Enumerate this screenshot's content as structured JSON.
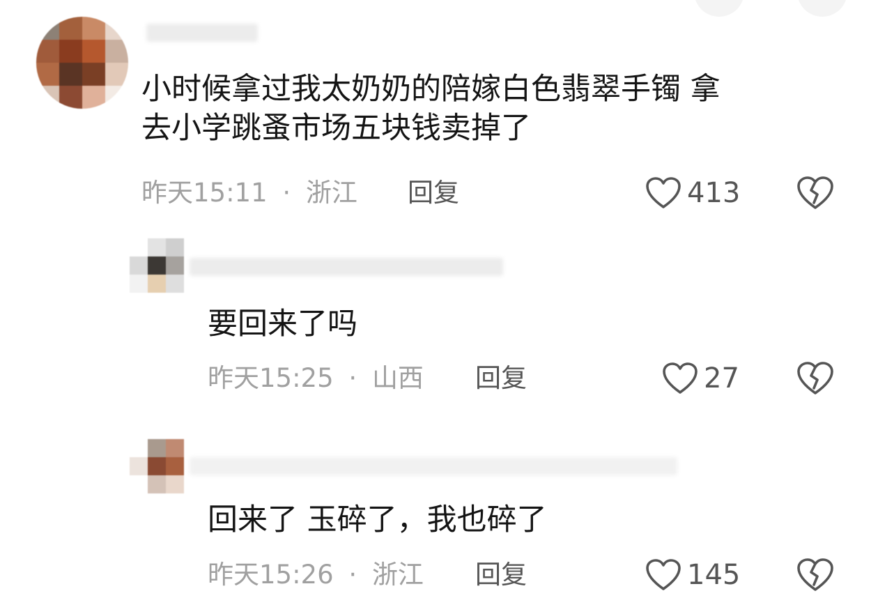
{
  "icons": {
    "like": "heart-outline-icon",
    "dislike": "broken-heart-icon"
  },
  "colors": {
    "text": "#141414",
    "meta": "#a0a0a0",
    "action": "#555555"
  },
  "comments": [
    {
      "text": "小时候拿过我太奶奶的陪嫁白色翡翠手镯 拿\n去小学跳蚤市场五块钱卖掉了",
      "time": "昨天15:11",
      "separator": "·",
      "location": "浙江",
      "reply_label": "回复",
      "likes": "413"
    },
    {
      "text": "要回来了吗",
      "time": "昨天15:25",
      "separator": "·",
      "location": "山西",
      "reply_label": "回复",
      "likes": "27"
    },
    {
      "text": "回来了 玉碎了，我也碎了",
      "time": "昨天15:26",
      "separator": "·",
      "location": "浙江",
      "reply_label": "回复",
      "likes": "145"
    }
  ]
}
